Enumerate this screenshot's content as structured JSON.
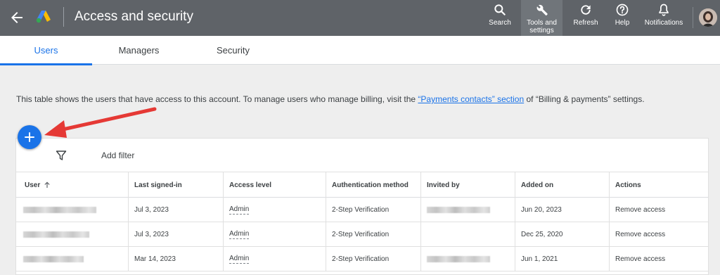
{
  "header": {
    "title": "Access and security",
    "tools": [
      {
        "label": "Search",
        "icon": "search-icon"
      },
      {
        "label": "Tools and settings",
        "icon": "wrench-icon"
      },
      {
        "label": "Refresh",
        "icon": "refresh-icon"
      },
      {
        "label": "Help",
        "icon": "help-icon"
      },
      {
        "label": "Notifications",
        "icon": "bell-icon"
      }
    ]
  },
  "tabs": [
    {
      "label": "Users",
      "active": true
    },
    {
      "label": "Managers",
      "active": false
    },
    {
      "label": "Security",
      "active": false
    }
  ],
  "description": {
    "before": "This table shows the users that have access to this account. To manage users who manage billing, visit the ",
    "link": "“Payments contacts” section",
    "after": " of “Billing & payments” settings."
  },
  "filter": {
    "label": "Add filter"
  },
  "table": {
    "columns": [
      "User",
      "Last signed-in",
      "Access level",
      "Authentication method",
      "Invited by",
      "Added on",
      "Actions"
    ],
    "rows": [
      {
        "user": "",
        "last_signed_in": "Jul 3, 2023",
        "access_level": "Admin",
        "auth_method": "2-Step Verification",
        "invited_by": "",
        "added_on": "Jun 20, 2023",
        "action": "Remove access"
      },
      {
        "user": "",
        "last_signed_in": "Jul 3, 2023",
        "access_level": "Admin",
        "auth_method": "2-Step Verification",
        "invited_by": "",
        "added_on": "Dec 25, 2020",
        "action": "Remove access"
      },
      {
        "user": "",
        "last_signed_in": "Mar 14, 2023",
        "access_level": "Admin",
        "auth_method": "2-Step Verification",
        "invited_by": "",
        "added_on": "Jun 1, 2021",
        "action": "Remove access"
      }
    ]
  },
  "colors": {
    "topbar": "#5f6368",
    "accent": "#1a73e8",
    "annotation_arrow": "#e53935"
  }
}
